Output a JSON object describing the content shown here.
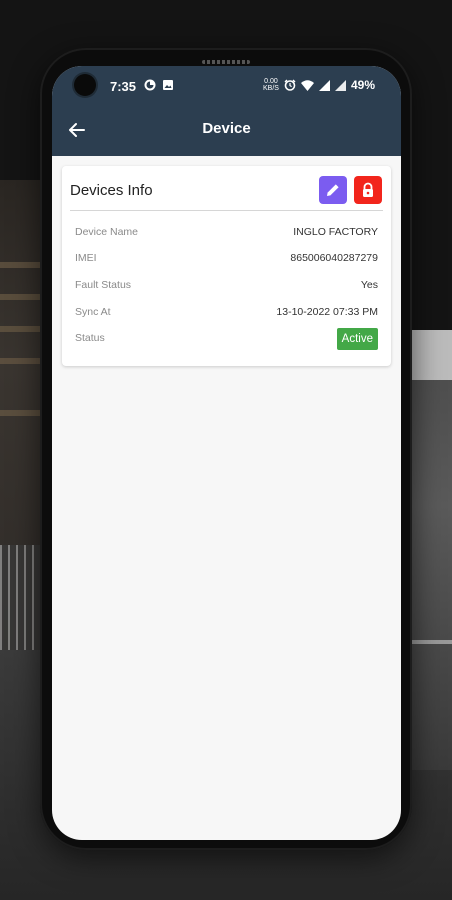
{
  "status_bar": {
    "time": "7:35",
    "net_speed_value": "0.00",
    "net_speed_unit": "KB/S",
    "battery": "49%",
    "icons": [
      "sync-icon",
      "image-icon",
      "alarm-icon",
      "wifi-icon",
      "signal-icon",
      "signal-icon"
    ]
  },
  "app_bar": {
    "title": "Device",
    "back_icon": "arrow-left-icon",
    "color": "#2c3e50"
  },
  "card": {
    "title": "Devices Info",
    "edit_icon": "pencil-icon",
    "lock_icon": "lock-icon",
    "edit_color": "#7b5cf0",
    "lock_color": "#f2251c",
    "rows": [
      {
        "label": "Device Name",
        "value": "INGLO FACTORY"
      },
      {
        "label": "IMEI",
        "value": "865006040287279"
      },
      {
        "label": "Fault Status",
        "value": "Yes"
      },
      {
        "label": "Sync At",
        "value": "13-10-2022 07:33 PM"
      },
      {
        "label": "Status",
        "value": "Active"
      }
    ],
    "status_color": "#43a847"
  }
}
